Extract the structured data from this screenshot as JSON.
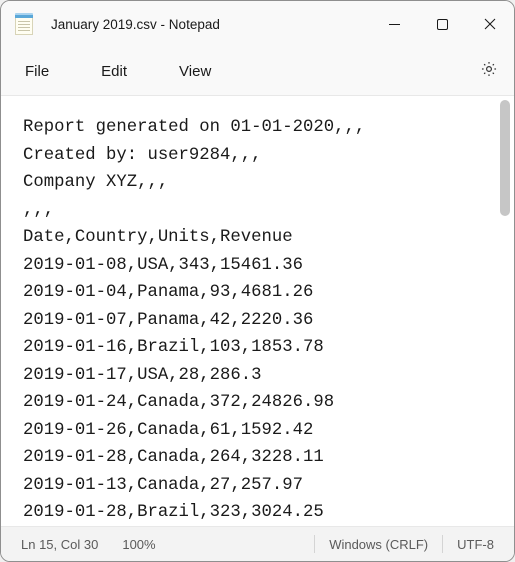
{
  "titlebar": {
    "title": "January 2019.csv - Notepad"
  },
  "menu": {
    "file": "File",
    "edit": "Edit",
    "view": "View"
  },
  "content": "Report generated on 01-01-2020,,,\nCreated by: user9284,,,\nCompany XYZ,,,\n,,,\nDate,Country,Units,Revenue\n2019-01-08,USA,343,15461.36\n2019-01-04,Panama,93,4681.26\n2019-01-07,Panama,42,2220.36\n2019-01-16,Brazil,103,1853.78\n2019-01-17,USA,28,286.3\n2019-01-24,Canada,372,24826.98\n2019-01-26,Canada,61,1592.42\n2019-01-28,Canada,264,3228.11\n2019-01-13,Canada,27,257.97\n2019-01-28,Brazil,323,3024.25",
  "status": {
    "position": "Ln 15, Col 30",
    "zoom": "100%",
    "line_ending": "Windows (CRLF)",
    "encoding": "UTF-8"
  }
}
